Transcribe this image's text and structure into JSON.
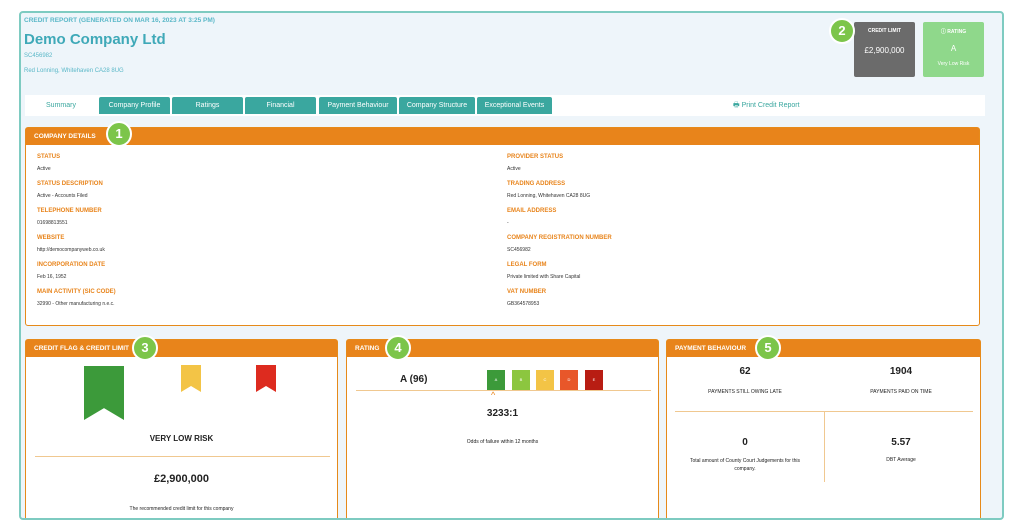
{
  "header": {
    "generated": "CREDIT REPORT (GENERATED ON MAR 16, 2023 AT 3:25 PM)",
    "company_name": "Demo Company Ltd",
    "reg_no": "SC456982",
    "address": "Red Lonning, Whitehaven CA28 8UG"
  },
  "summary_boxes": {
    "credit_limit_label": "CREDIT LIMIT",
    "credit_limit_value": "£2,900,000",
    "rating_label": "RATING",
    "rating_value": "A",
    "rating_sub": "Very Low Risk"
  },
  "badges": [
    "1",
    "2",
    "3",
    "4",
    "5"
  ],
  "tabs": [
    {
      "label": "Summary"
    },
    {
      "label": "Company Profile"
    },
    {
      "label": "Ratings"
    },
    {
      "label": "Financial"
    },
    {
      "label": "Payment Behaviour"
    },
    {
      "label": "Company Structure"
    },
    {
      "label": "Exceptional Events"
    }
  ],
  "print_label": "Print Credit Report",
  "company_details": {
    "title": "COMPANY DETAILS",
    "left": [
      {
        "label": "STATUS",
        "value": "Active"
      },
      {
        "label": "STATUS DESCRIPTION",
        "value": "Active - Accounts Filed"
      },
      {
        "label": "TELEPHONE NUMBER",
        "value": "01698813551"
      },
      {
        "label": "WEBSITE",
        "value": "http://democompanyweb.co.uk"
      },
      {
        "label": "INCORPORATION DATE",
        "value": "Feb 16, 1952"
      },
      {
        "label": "MAIN ACTIVITY (SIC CODE)",
        "value": "32990 - Other manufacturing n.e.c."
      }
    ],
    "right": [
      {
        "label": "PROVIDER STATUS",
        "value": "Active"
      },
      {
        "label": "TRADING ADDRESS",
        "value": "Red Lonning, Whitehaven CA28 8UG"
      },
      {
        "label": "EMAIL ADDRESS",
        "value": "-"
      },
      {
        "label": "COMPANY REGISTRATION NUMBER",
        "value": "SC456982"
      },
      {
        "label": "LEGAL FORM",
        "value": "Private limited with Share Capital"
      },
      {
        "label": "VAT NUMBER",
        "value": "GB364578953"
      }
    ]
  },
  "credit_flag": {
    "title": "CREDIT FLAG & CREDIT LIMIT",
    "risk": "VERY LOW RISK",
    "limit": "£2,900,000",
    "note": "The recommended credit limit for this company"
  },
  "rating": {
    "title": "RATING",
    "value": "A (96)",
    "scale": [
      "A",
      "B",
      "C",
      "D",
      "E"
    ],
    "scale_colors": [
      "#3c9a3a",
      "#8cc63f",
      "#f3c446",
      "#e8572a",
      "#b81d13"
    ],
    "odds": "3233:1",
    "odds_note": "Odds of failure within 12 months"
  },
  "payment": {
    "title": "PAYMENT BEHAVIOUR",
    "late_value": "62",
    "late_label": "PAYMENTS STILL OWING LATE",
    "ontime_value": "1904",
    "ontime_label": "PAYMENTS PAID ON TIME",
    "ccj_value": "0",
    "ccj_label": "Total amount of County Court Judgements for this company.",
    "dbt_value": "5.57",
    "dbt_label": "DBT Average"
  }
}
